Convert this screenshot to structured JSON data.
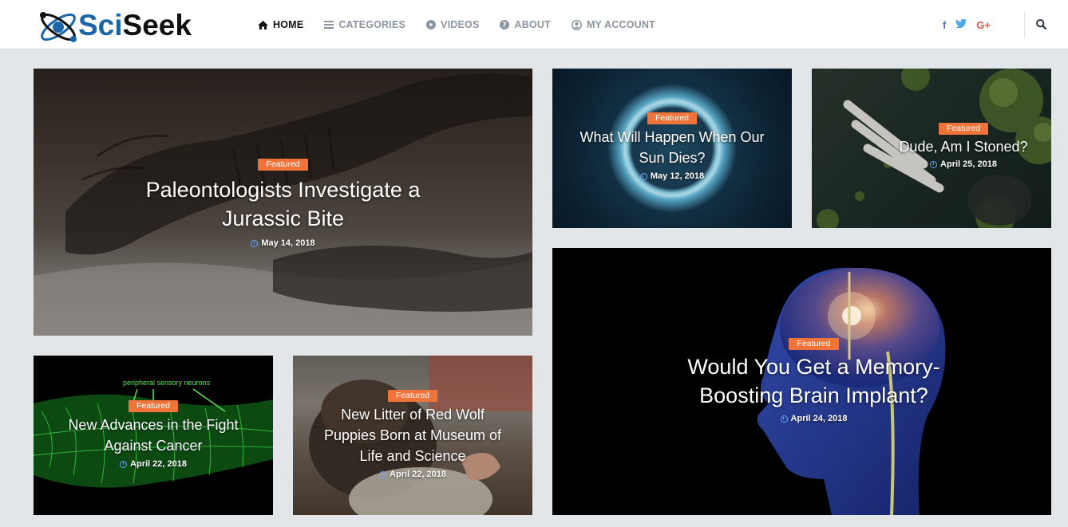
{
  "brand": {
    "name_part1": "Sci",
    "name_part2": "Seek"
  },
  "nav": {
    "items": [
      {
        "label": "HOME",
        "icon": "home-icon"
      },
      {
        "label": "CATEGORIES",
        "icon": "menu-icon"
      },
      {
        "label": "VIDEOS",
        "icon": "play-icon"
      },
      {
        "label": "ABOUT",
        "icon": "question-icon"
      },
      {
        "label": "MY ACCOUNT",
        "icon": "user-icon"
      }
    ]
  },
  "social": {
    "facebook": "f",
    "twitter": "twitter-icon",
    "google": "G+"
  },
  "colors": {
    "accent": "#f0743a",
    "nav_inactive": "#8a95a0",
    "brand_blue": "#1b66a8",
    "background": "#e3e6e8"
  },
  "posts": [
    {
      "badge": "Featured",
      "title": "Paleontologists Investigate a Jurassic Bite",
      "date": "May 14, 2018"
    },
    {
      "badge": "Featured",
      "title": "What Will Happen When Our Sun Dies?",
      "date": "May 12, 2018"
    },
    {
      "badge": "Featured",
      "title": "Dude, Am I Stoned?",
      "date": "April 25, 2018"
    },
    {
      "badge": "Featured",
      "title": "Would You Get a Memory-Boosting Brain Implant?",
      "date": "April 24, 2018"
    },
    {
      "badge": "Featured",
      "title": "New Advances in the Fight Against Cancer",
      "date": "April 22, 2018",
      "image_text": "peripheral sensory neurons"
    },
    {
      "badge": "Featured",
      "title": "New Litter of Red Wolf Puppies Born at Museum of Life and Science",
      "date": "April 22, 2018"
    }
  ]
}
